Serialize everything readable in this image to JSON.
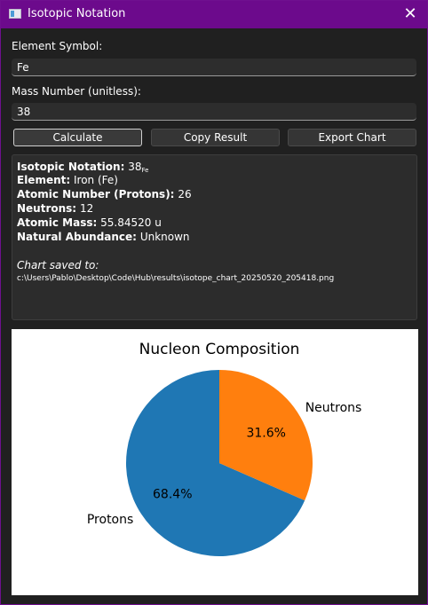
{
  "window": {
    "title": "Isotopic Notation",
    "close_glyph": "✕"
  },
  "form": {
    "element_label": "Element Symbol:",
    "element_value": "Fe",
    "mass_label": "Mass Number (unitless):",
    "mass_value": "38"
  },
  "buttons": {
    "calculate": "Calculate",
    "copy": "Copy Result",
    "export": "Export Chart"
  },
  "result": {
    "notation_label": "Isotopic Notation:",
    "notation_value": "38",
    "notation_sub": "Fe",
    "element_label": "Element:",
    "element_value": "Iron (Fe)",
    "atomic_number_label": "Atomic Number (Protons):",
    "atomic_number_value": "26",
    "neutrons_label": "Neutrons:",
    "neutrons_value": "12",
    "atomic_mass_label": "Atomic Mass:",
    "atomic_mass_value": "55.84520 u",
    "abundance_label": "Natural Abundance:",
    "abundance_value": "Unknown",
    "chart_saved_label": "Chart saved to:",
    "chart_saved_path": "c:\\Users\\Pablo\\Desktop\\Code\\Hub\\results\\isotope_chart_20250520_205418.png"
  },
  "chart_data": {
    "type": "pie",
    "title": "Nucleon Composition",
    "categories": [
      "Protons",
      "Neutrons"
    ],
    "values": [
      26,
      12
    ],
    "percent_labels": [
      "68.4%",
      "31.6%"
    ],
    "colors": [
      "#1f77b4",
      "#ff7f0e"
    ],
    "start_angle_deg": 90,
    "direction": "counterclockwise"
  },
  "theme": {
    "window_bg": "#202020",
    "titlebar_bg": "#6c0a8c"
  }
}
